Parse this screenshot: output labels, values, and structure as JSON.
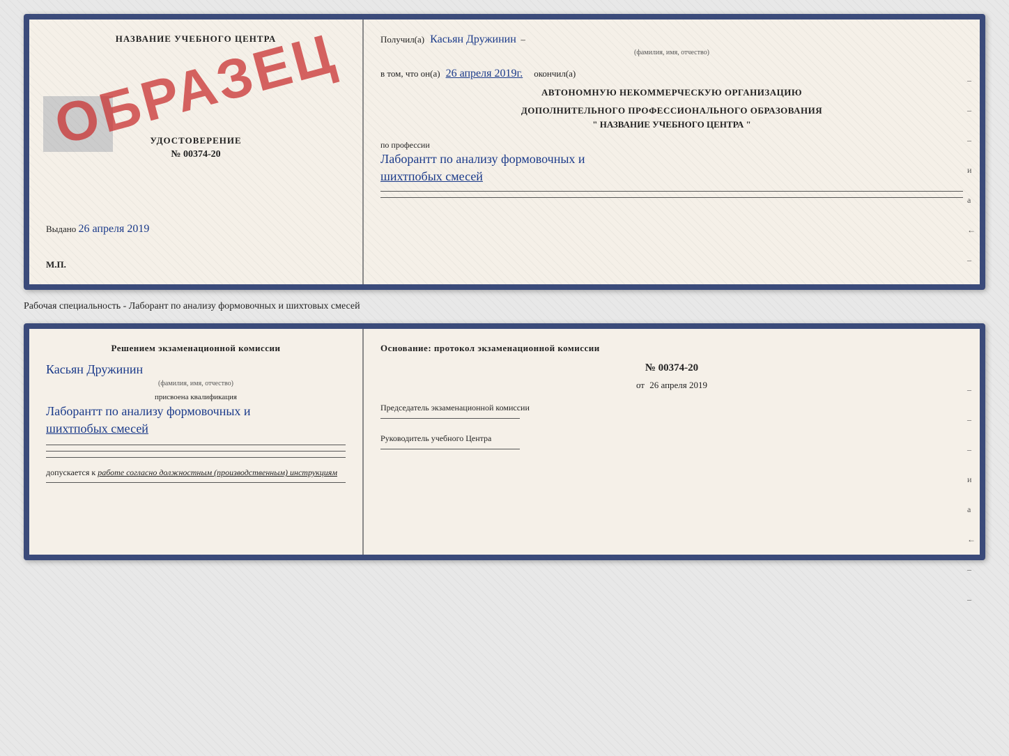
{
  "topDoc": {
    "left": {
      "title": "НАЗВАНИЕ УЧЕБНОГО ЦЕНТРА",
      "obrazec": "ОБРАЗЕЦ",
      "cert_label": "УДОСТОВЕРЕНИЕ",
      "cert_number": "№ 00374-20",
      "gray_box": true,
      "vudano": "Выдано",
      "vudano_date": "26 апреля 2019",
      "mp": "М.П."
    },
    "right": {
      "poluchil": "Получил(а)",
      "name_handwritten": "Касьян Дружинин",
      "name_sublabel": "(фамилия, имя, отчество)",
      "vtom_label": "в том, что он(а)",
      "date_handwritten": "26 апреля 2019г.",
      "okonchil": "окончил(а)",
      "org_line1": "АВТОНОМНУЮ НЕКОММЕРЧЕСКУЮ ОРГАНИЗАЦИЮ",
      "org_line2": "ДОПОЛНИТЕЛЬНОГО ПРОФЕССИОНАЛЬНОГО ОБРАЗОВАНИЯ",
      "org_name": "\"  НАЗВАНИЕ УЧЕБНОГО ЦЕНТРА  \"",
      "prof_label": "по профессии",
      "prof_handwritten_1": "Лаборантт по анализу формовочных и",
      "prof_handwritten_2": "шихтпобых смесей",
      "side_marks": [
        "-",
        "-",
        "-",
        "и",
        "а",
        "←",
        "-",
        "-"
      ]
    }
  },
  "separator": {
    "text": "Рабочая специальность - Лаборант по анализу формовочных и шихтовых смесей"
  },
  "bottomDoc": {
    "left": {
      "title": "Решением экзаменационной комиссии",
      "name_handwritten": "Касьян Дружинин",
      "name_sublabel": "(фамилия, имя, отчество)",
      "kval_label": "присвоена квалификация",
      "kval_handwritten_1": "Лаборантт по анализу формовочных и",
      "kval_handwritten_2": "шихтпобых смесей",
      "допуск_label": "допускается к",
      "допуск_text": "работе согласно должностным (производственным) инструкциям"
    },
    "right": {
      "osnov_label": "Основание: протокол экзаменационной комиссии",
      "prot_number": "№ 00374-20",
      "from_label": "от",
      "from_date": "26 апреля 2019",
      "chairman_label": "Председатель экзаменационной комиссии",
      "rukov_label": "Руководитель учебного Центра",
      "side_marks": [
        "-",
        "-",
        "-",
        "и",
        "а",
        "←",
        "-",
        "-"
      ]
    }
  }
}
